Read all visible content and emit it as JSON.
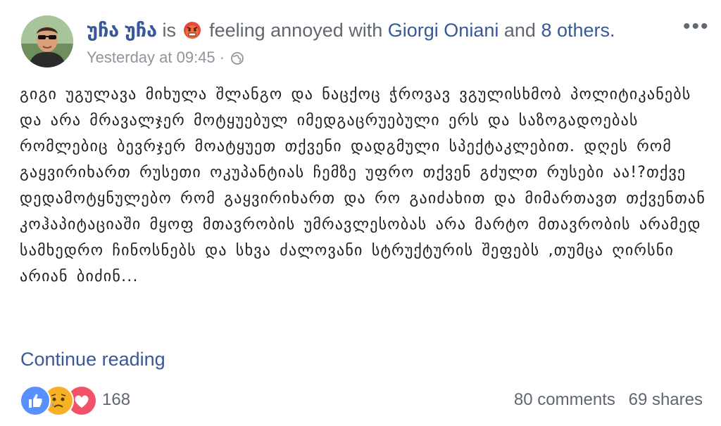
{
  "header": {
    "author": "უჩა უჩა",
    "is_word": "is",
    "feeling_icon": "angry-face-icon",
    "feeling_text": "feeling annoyed with",
    "tagged_person": "Giorgi Oniani",
    "and_word": "and",
    "others_link": "8 others.",
    "timestamp": "Yesterday at 09:45",
    "separator": "·",
    "privacy_icon": "globe-icon",
    "options_icon": "more-horizontal-icon",
    "options_glyph": "•••"
  },
  "post": {
    "text": "გიგი უგულავა მიხულა შლანგო და ნაცქოც ჭროვავ ვგულისხმობ პოლიტიკანებს და არა მრავალჯერ მოტყუებულ იმედგაცრუებული ერს და საზოგადოებას რომლებიც ბევრჯერ მოატყუეთ თქვენი დადგმული სპექტაკლებით. დღეს რომ გაყვირიხართ რუსეთი ოკუპანტიას ჩემზე უფრო თქვენ გძულთ რუსები აა!?თქვე დედამოტყნულებო რომ გაყვირიხართ და რო გაიძახით და მიმართავთ თქვენთან კოჰაპიტაციაში მყოფ მთავრობის უმრავლესობას არა მარტო მთავრობის არამედ სამხედრო ჩინოსნებს და სხვა ძალოვანი სტრუქტურის შეფებს ,თუმცა ღირსნი არიან ბიძინ...",
    "continue_label": "Continue reading"
  },
  "footer": {
    "reaction_icons": [
      "like-icon",
      "sad-icon",
      "love-icon"
    ],
    "reaction_count": "168",
    "comments": "80 comments",
    "shares": "69 shares"
  },
  "colors": {
    "link": "#385898",
    "meta": "#90949c",
    "like": "#5890ff",
    "sad": "#f7b125",
    "love": "#f25268"
  }
}
